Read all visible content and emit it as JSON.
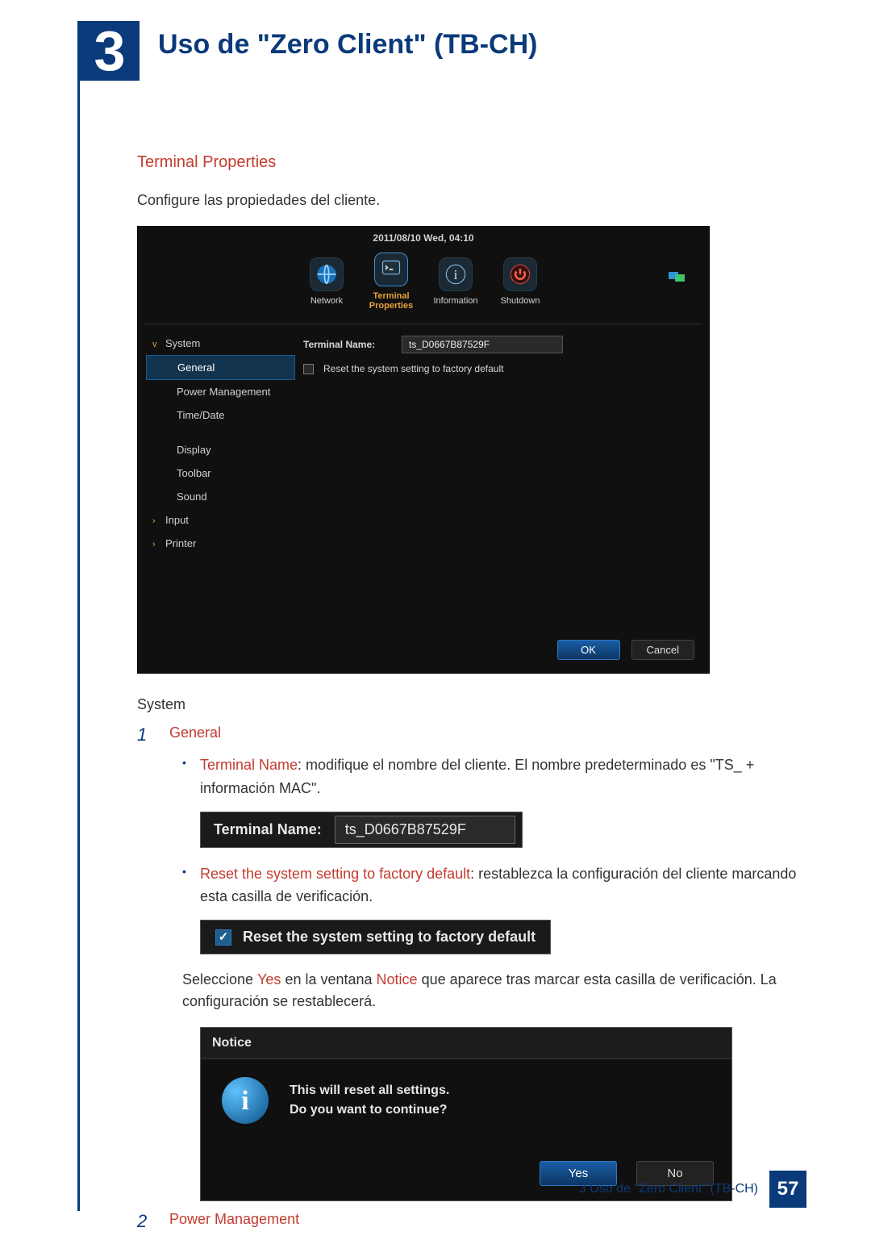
{
  "chapter": {
    "number": "3",
    "title": "Uso de \"Zero Client\" (TB-CH)"
  },
  "section_heading": "Terminal Properties",
  "intro": "Configure las propiedades del cliente.",
  "shotA": {
    "datetime": "2011/08/10 Wed, 04:10",
    "tools": {
      "network": "Network",
      "terminal_properties_l1": "Terminal",
      "terminal_properties_l2": "Properties",
      "information": "Information",
      "shutdown": "Shutdown"
    },
    "sidebar": {
      "system": "System",
      "general": "General",
      "power_management": "Power Management",
      "time_date": "Time/Date",
      "display": "Display",
      "toolbar": "Toolbar",
      "sound": "Sound",
      "input": "Input",
      "printer": "Printer"
    },
    "panel": {
      "terminal_name_label": "Terminal Name:",
      "terminal_name_value": "ts_D0667B87529F",
      "reset_label": "Reset the system setting to factory default"
    },
    "buttons": {
      "ok": "OK",
      "cancel": "Cancel"
    }
  },
  "sub_heading": "System",
  "item1": {
    "num": "1",
    "title": "General",
    "b1_term": "Terminal Name",
    "b1_rest": ": modifique el nombre del cliente. El nombre predeterminado es \"TS_ + información MAC\".",
    "strip_name_label": "Terminal Name:",
    "strip_name_value": "ts_D0667B87529F",
    "b2_term": "Reset the system setting to factory default",
    "b2_rest": ": restablezca la configuración del cliente marcando esta casilla de verificación.",
    "strip_reset_label": "Reset the system setting to factory default",
    "p_pre": "Seleccione ",
    "p_yes": "Yes",
    "p_mid": " en la ventana ",
    "p_notice": "Notice",
    "p_post": " que aparece tras marcar esta casilla de verificación. La configuración se restablecerá."
  },
  "notice": {
    "title": "Notice",
    "line1": "This will reset all settings.",
    "line2": "Do you want to continue?",
    "yes": "Yes",
    "no": "No",
    "info_glyph": "i"
  },
  "item2": {
    "num": "2",
    "title": "Power Management"
  },
  "footer": {
    "text": "3 Uso de \"Zero Client\" (TB-CH)",
    "page": "57"
  }
}
